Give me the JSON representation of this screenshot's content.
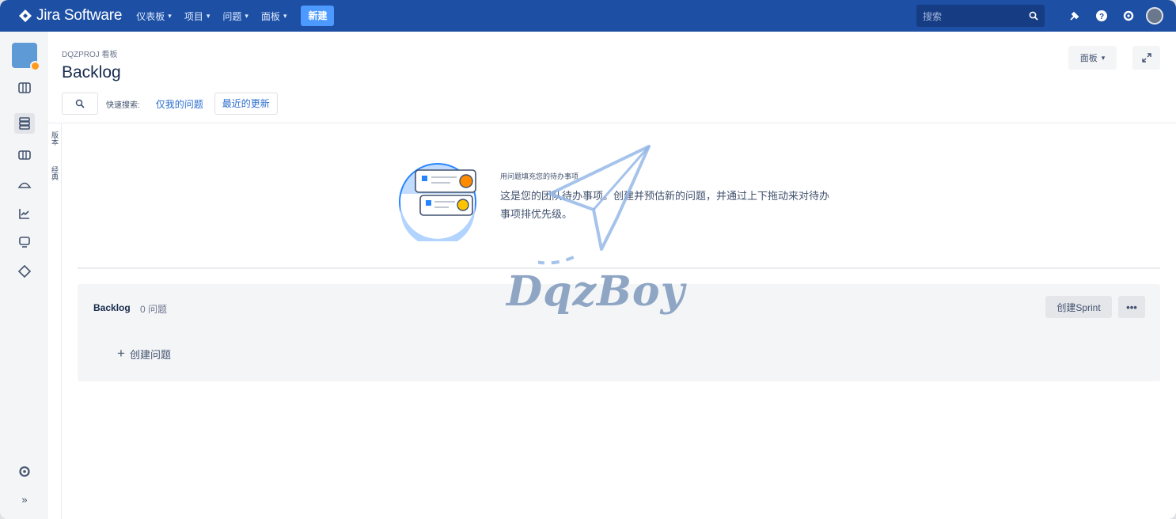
{
  "nav": {
    "product": "Jira Software",
    "menus": [
      {
        "label": "仪表板"
      },
      {
        "label": "项目"
      },
      {
        "label": "问题"
      },
      {
        "label": "面板"
      }
    ],
    "create_label": "新建",
    "search_placeholder": "搜索"
  },
  "header": {
    "breadcrumb": "DQZPROJ 看板",
    "title": "Backlog",
    "board_button": "面板",
    "quick_filters_label": "快速搜索:",
    "quick_filters": [
      "仅我的问题",
      "最近的更新"
    ]
  },
  "side_tabs": [
    "版本",
    "经典"
  ],
  "empty_state": {
    "heading": "用问题填充您的待办事项",
    "body": "这是您的团队待办事项。创建并预估新的问题，并通过上下拖动来对待办事项排优先级。"
  },
  "backlog": {
    "title": "Backlog",
    "count": "0 问题",
    "create_sprint": "创建Sprint",
    "more": "•••",
    "create_issue": "创建问题"
  },
  "watermark": "DqzBoy",
  "colors": {
    "nav_bg": "#1d4fa4",
    "create_button": "#4c9aff",
    "link": "#2b6ecf"
  }
}
